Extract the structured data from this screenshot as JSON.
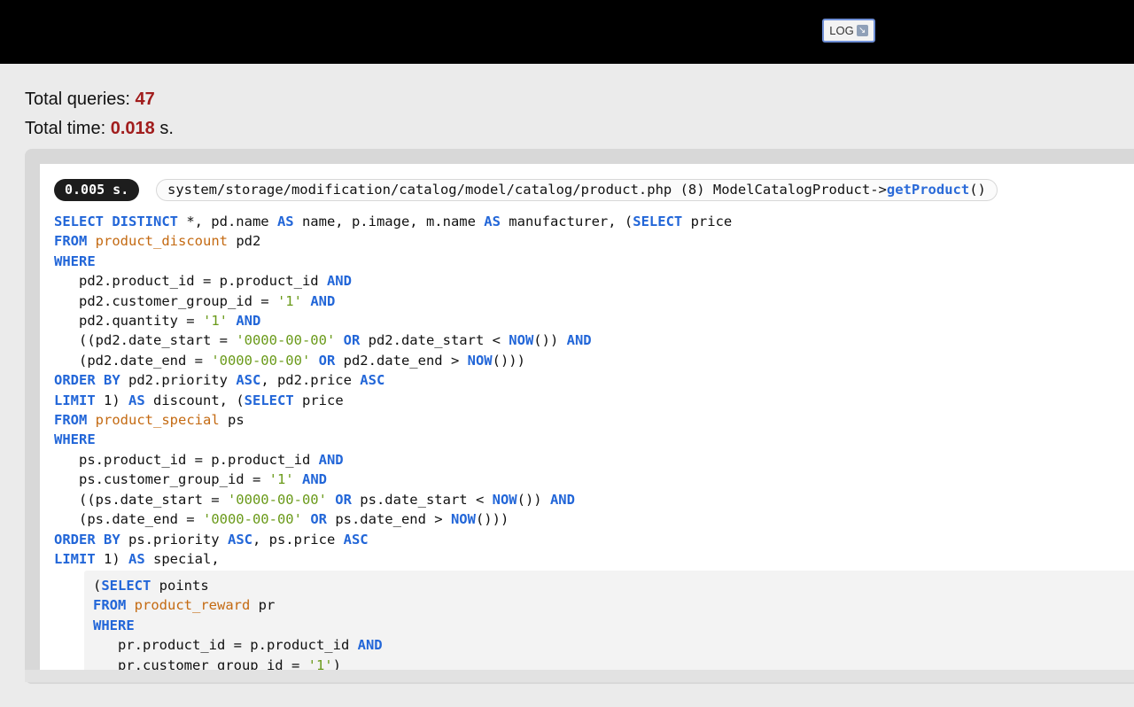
{
  "header": {
    "log_button_label": "LOG",
    "log_icon": "arrow-down-box-icon"
  },
  "stats": {
    "queries_label": "Total queries:",
    "queries_value": "47",
    "time_label": "Total time:",
    "time_value": "0.018",
    "time_unit": "s."
  },
  "query": {
    "time_badge": "0.005 s.",
    "path": "system/storage/modification/catalog/model/catalog/product.php (8) ModelCatalogProduct->",
    "method": "getProduct",
    "call_suffix": "()"
  },
  "colors": {
    "keyword": "#2266d8",
    "table": "#c46a12",
    "string": "#6a9a1a",
    "stat_value": "#a11d1d"
  },
  "sql": {
    "l1": {
      "a": "SELECT DISTINCT",
      "b": " *, pd.name ",
      "c": "AS",
      "d": " name, p.image, m.name ",
      "e": "AS",
      "f": " manufacturer, (",
      "g": "SELECT",
      "h": " price"
    },
    "l2": {
      "a": "FROM",
      "b": " ",
      "c": "product_discount",
      "d": " pd2"
    },
    "l3": {
      "a": "WHERE"
    },
    "l4": {
      "a": "   pd2.product_id = p.product_id ",
      "b": "AND"
    },
    "l5": {
      "a": "   pd2.customer_group_id = ",
      "b": "'1'",
      "c": " ",
      "d": "AND"
    },
    "l6": {
      "a": "   pd2.quantity = ",
      "b": "'1'",
      "c": " ",
      "d": "AND"
    },
    "l7": {
      "a": "   ((pd2.date_start = ",
      "b": "'0000-00-00'",
      "c": " ",
      "d": "OR",
      "e": " pd2.date_start < ",
      "f": "NOW",
      "g": "()) ",
      "h": "AND"
    },
    "l8": {
      "a": "   (pd2.date_end = ",
      "b": "'0000-00-00'",
      "c": " ",
      "d": "OR",
      "e": " pd2.date_end > ",
      "f": "NOW",
      "g": "()))"
    },
    "l9": {
      "a": "ORDER BY",
      "b": " pd2.priority ",
      "c": "ASC",
      "d": ", pd2.price ",
      "e": "ASC"
    },
    "l10": {
      "a": "LIMIT",
      "b": " 1) ",
      "c": "AS",
      "d": " discount, (",
      "e": "SELECT",
      "f": " price"
    },
    "l11": {
      "a": "FROM",
      "b": " ",
      "c": "product_special",
      "d": " ps"
    },
    "l12": {
      "a": "WHERE"
    },
    "l13": {
      "a": "   ps.product_id = p.product_id ",
      "b": "AND"
    },
    "l14": {
      "a": "   ps.customer_group_id = ",
      "b": "'1'",
      "c": " ",
      "d": "AND"
    },
    "l15": {
      "a": "   ((ps.date_start = ",
      "b": "'0000-00-00'",
      "c": " ",
      "d": "OR",
      "e": " ps.date_start < ",
      "f": "NOW",
      "g": "()) ",
      "h": "AND"
    },
    "l16": {
      "a": "   (ps.date_end = ",
      "b": "'0000-00-00'",
      "c": " ",
      "d": "OR",
      "e": " ps.date_end > ",
      "f": "NOW",
      "g": "()))"
    },
    "l17": {
      "a": "ORDER BY",
      "b": " ps.priority ",
      "c": "ASC",
      "d": ", ps.price ",
      "e": "ASC"
    },
    "l18": {
      "a": "LIMIT",
      "b": " 1) ",
      "c": "AS",
      "d": " special,"
    },
    "s1": {
      "a": "(",
      "b": "SELECT",
      "c": " points"
    },
    "s2": {
      "a": "FROM",
      "b": " ",
      "c": "product_reward",
      "d": " pr"
    },
    "s3": {
      "a": "WHERE"
    },
    "s4": {
      "a": "   pr.product_id = p.product_id ",
      "b": "AND"
    },
    "s5": {
      "a": "   pr.customer_group_id = ",
      "b": "'1'",
      "c": ")"
    }
  }
}
